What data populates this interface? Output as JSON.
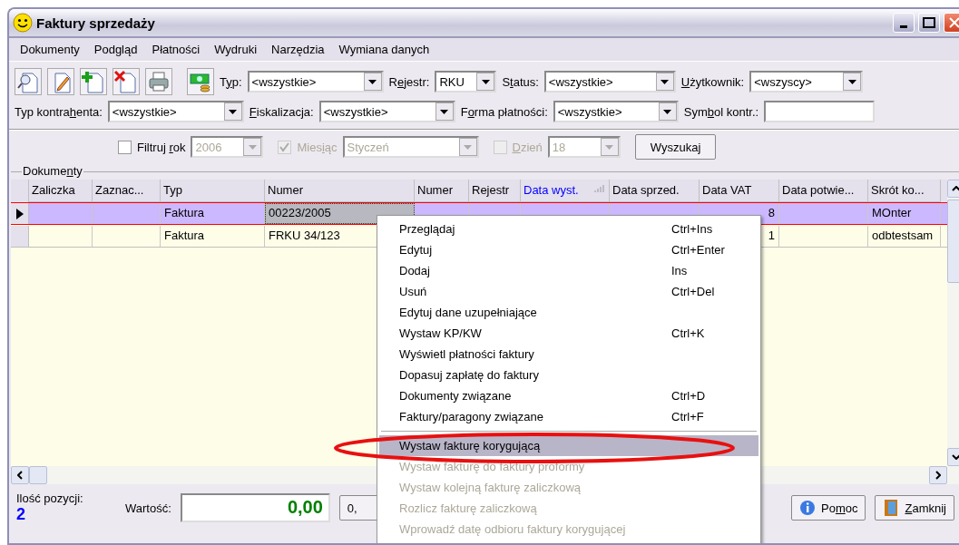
{
  "window": {
    "title": "Faktury sprzedaży"
  },
  "menu_bar": [
    "Dokumenty",
    "Podgląd",
    "Płatności",
    "Wydruki",
    "Narzędzia",
    "Wymiana danych"
  ],
  "filters_row_1": [
    {
      "kind": "select",
      "label": "Typ:",
      "value": "<wszystkie>"
    },
    {
      "kind": "select",
      "label": "Rejestr:",
      "value": "RKU"
    },
    {
      "kind": "select",
      "label": "Status:",
      "value": "<wszystkie>"
    },
    {
      "kind": "select",
      "label": "Użytkownik:",
      "value": "<wszyscy>"
    }
  ],
  "filters_row_2": [
    {
      "kind": "select",
      "label": "Typ kontrahenta:",
      "value": "<wszystkie>"
    },
    {
      "kind": "select",
      "label": "Fiskalizacja:",
      "value": "<wszystkie>"
    },
    {
      "kind": "select",
      "label": "Forma płatności:",
      "value": "<wszystkie>"
    },
    {
      "kind": "text",
      "label": "Symbol kontr.:"
    }
  ],
  "date_filter": [
    {
      "label": "Filtruj rok",
      "checked": false,
      "disabled": false,
      "value": "2006"
    },
    {
      "label": "Miesiąc",
      "checked": true,
      "disabled": true,
      "value": "Styczeń"
    },
    {
      "label": "Dzień",
      "checked": false,
      "disabled": true,
      "value": "18"
    }
  ],
  "search_button": "Wyszukaj",
  "group_title": "Dokumenty",
  "table": {
    "columns": [
      {
        "label": "Zaliczka",
        "sorted": false
      },
      {
        "label": "Zaznac...",
        "sorted": false
      },
      {
        "label": "Typ",
        "sorted": false
      },
      {
        "label": "Numer",
        "sorted": false
      },
      {
        "label": "Numer",
        "sorted": false
      },
      {
        "label": "Rejestr",
        "sorted": false
      },
      {
        "label": "Data wyst.",
        "sorted": true
      },
      {
        "label": "Data sprzed.",
        "sorted": false
      },
      {
        "label": "Data VAT",
        "sorted": false
      },
      {
        "label": "Data potwie...",
        "sorted": false
      },
      {
        "label": "Skrót ko...",
        "sorted": false
      }
    ],
    "rows": [
      {
        "selected": true,
        "cells": [
          null,
          null,
          "Faktura",
          "00223/2005",
          null,
          null,
          null,
          null,
          "8",
          null,
          "MOnter"
        ]
      },
      {
        "selected": false,
        "cells": [
          null,
          null,
          "Faktura",
          "FRKU 34/123",
          null,
          null,
          null,
          null,
          "1",
          null,
          "odbtestsam"
        ]
      }
    ]
  },
  "context_menu": [
    {
      "label": "Przeglądaj",
      "shortcut": "Ctrl+Ins",
      "disabled": false,
      "selected": false
    },
    {
      "label": "Edytuj",
      "shortcut": "Ctrl+Enter",
      "disabled": false,
      "selected": false
    },
    {
      "label": "Dodaj",
      "shortcut": "Ins",
      "disabled": false,
      "selected": false
    },
    {
      "label": "Usuń",
      "shortcut": "Ctrl+Del",
      "disabled": false,
      "selected": false
    },
    {
      "label": "Edytuj dane uzupełniające",
      "disabled": false,
      "selected": false
    },
    {
      "label": "Wystaw KP/KW",
      "shortcut": "Ctrl+K",
      "disabled": false,
      "selected": false
    },
    {
      "label": "Wyświetl płatności faktury",
      "disabled": false,
      "selected": false
    },
    {
      "label": "Dopasuj zapłatę do faktury",
      "disabled": false,
      "selected": false
    },
    {
      "label": "Dokumenty związane",
      "shortcut": "Ctrl+D",
      "disabled": false,
      "selected": false
    },
    {
      "label": "Faktury/paragony związane",
      "shortcut": "Ctrl+F",
      "disabled": false,
      "selected": false
    },
    {
      "kind": "separator"
    },
    {
      "label": "Wystaw fakturę korygującą",
      "disabled": false,
      "selected": true
    },
    {
      "label": "Wystaw fakturę do faktury proformy",
      "disabled": true,
      "selected": false
    },
    {
      "label": "Wystaw kolejną fakturę zaliczkową",
      "disabled": true,
      "selected": false
    },
    {
      "label": "Rozlicz fakturę zaliczkową",
      "disabled": true,
      "selected": false
    },
    {
      "label": "Wprowadź datę odbioru faktury korygującej",
      "disabled": true,
      "selected": false
    }
  ],
  "footer": {
    "count_label": "Ilość pozycji:",
    "count": "2",
    "value_label": "Wartość:",
    "value": "0,00",
    "partial_button": "0,",
    "buttons": [
      {
        "kind": "help",
        "label": "Pomoc"
      },
      {
        "kind": "close",
        "label": "Zamknij"
      }
    ]
  }
}
